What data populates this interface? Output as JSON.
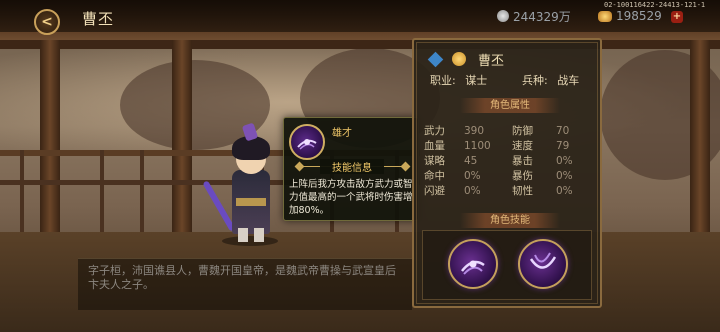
{
  "header": {
    "title": "曹丕",
    "build_id": "02-100116422-24413-121-1",
    "silver_amount": "244329万",
    "gold_amount": "198529",
    "plus_label": "+",
    "back_label": "<"
  },
  "colors": {
    "accent_gold": "#f2c96a",
    "panel_border": "#8a6a3e",
    "tooltip_bg": "#10120a",
    "skill_purple": "#5b2a88"
  },
  "hero_description": "字子桓，沛国谯县人，曹魏开国皇帝，是魏武帝曹操与武宣皇后卞夫人之子。",
  "tooltip": {
    "skill_name": "雄才",
    "section_title": "技能信息",
    "body": "上阵后我方攻击敌方武力或智力值最高的一个武将时伤害增加80%。"
  },
  "panel": {
    "hero_name": "曹丕",
    "job_label": "职业:",
    "job_value": "谋士",
    "troop_label": "兵种:",
    "troop_value": "战车",
    "attributes_title": "角色属性",
    "skills_title": "角色技能",
    "stats": [
      [
        "武力",
        "390",
        "防御",
        "70"
      ],
      [
        "血量",
        "1100",
        "速度",
        "79"
      ],
      [
        "谋略",
        "45",
        "暴击",
        "0%"
      ],
      [
        "命中",
        "0%",
        "暴伤",
        "0%"
      ],
      [
        "闪避",
        "0%",
        "韧性",
        "0%"
      ]
    ]
  },
  "icons": {
    "back": "arrow-left-icon",
    "silver": "silver-coin-icon",
    "gold": "gold-ingot-icon",
    "badge": "diamond-badge-icon",
    "element": "gold-orb-icon",
    "skill": "purple-blade-skill-icon"
  }
}
